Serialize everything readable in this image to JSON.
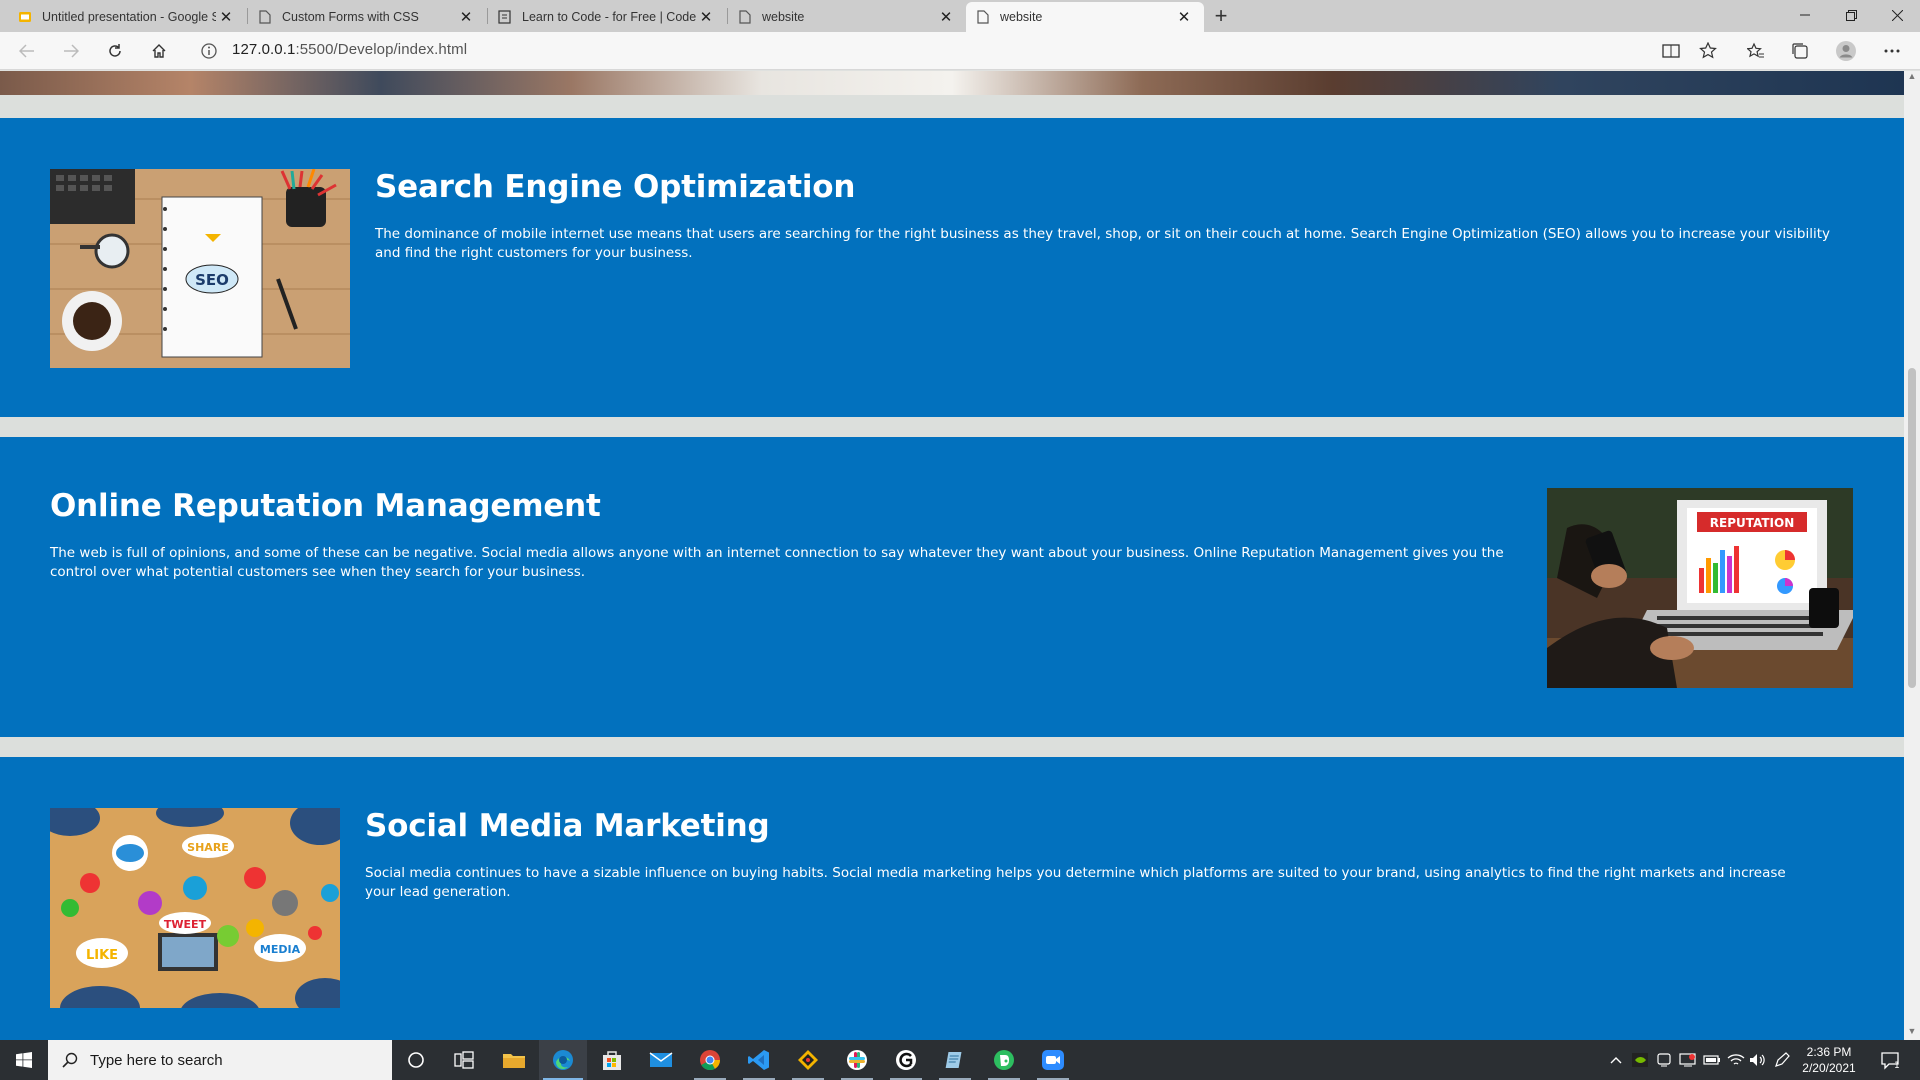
{
  "browser": {
    "tabs": [
      {
        "title": "Untitled presentation - Google S",
        "icon": "google-slides-icon"
      },
      {
        "title": "Custom Forms with CSS",
        "icon": "page-icon"
      },
      {
        "title": "Learn to Code - for Free | Codec",
        "icon": "codecademy-icon"
      },
      {
        "title": "website",
        "icon": "page-icon"
      },
      {
        "title": "website",
        "icon": "page-icon",
        "active": true
      }
    ],
    "url_host": "127.0.0.1",
    "url_path": ":5500/Develop/index.html"
  },
  "page": {
    "sections": [
      {
        "title": "Search Engine Optimization",
        "body": "The dominance of mobile internet use means that users are searching for the right business as they travel, shop, or sit on their couch at home. Search Engine Optimization (SEO) allows you to increase your visibility and find the right customers for your business.",
        "image_label": "SEO"
      },
      {
        "title": "Online Reputation Management",
        "body": "The web is full of opinions, and some of these can be negative. Social media allows anyone with an internet connection to say whatever they want about your business. Online Reputation Management gives you the control over what potential customers see when they search for your business.",
        "image_label": "REPUTATION"
      },
      {
        "title": "Social Media Marketing",
        "body": "Social media continues to have a sizable influence on buying habits. Social media marketing helps you determine which platforms are suited to your brand, using analytics to find the right markets and increase your lead generation.",
        "image_words": [
          "SHARE",
          "TWEET",
          "LIKE",
          "MEDIA"
        ]
      }
    ]
  },
  "taskbar": {
    "search_placeholder": "Type here to search",
    "time": "2:36 PM",
    "date": "2/20/2021",
    "notification_count": "1"
  },
  "colors": {
    "section_bg": "#0271be",
    "page_bg": "#dcdfdc",
    "taskbar_bg": "#2b2f33"
  }
}
